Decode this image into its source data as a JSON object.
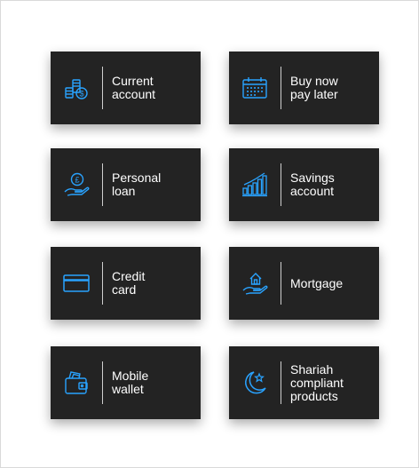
{
  "accent_color": "#29a3ff",
  "tile_background": "#232323",
  "products": [
    {
      "label": "Current\naccount",
      "icon": "coins-icon"
    },
    {
      "label": "Buy now\npay later",
      "icon": "calendar-icon"
    },
    {
      "label": "Personal\nloan",
      "icon": "pound-hand-icon"
    },
    {
      "label": "Savings\naccount",
      "icon": "growth-chart-icon"
    },
    {
      "label": "Credit\ncard",
      "icon": "credit-card-icon"
    },
    {
      "label": "Mortgage",
      "icon": "house-hand-icon"
    },
    {
      "label": "Mobile\nwallet",
      "icon": "wallet-icon"
    },
    {
      "label": "Shariah\ncompliant\nproducts",
      "icon": "crescent-star-icon"
    }
  ]
}
